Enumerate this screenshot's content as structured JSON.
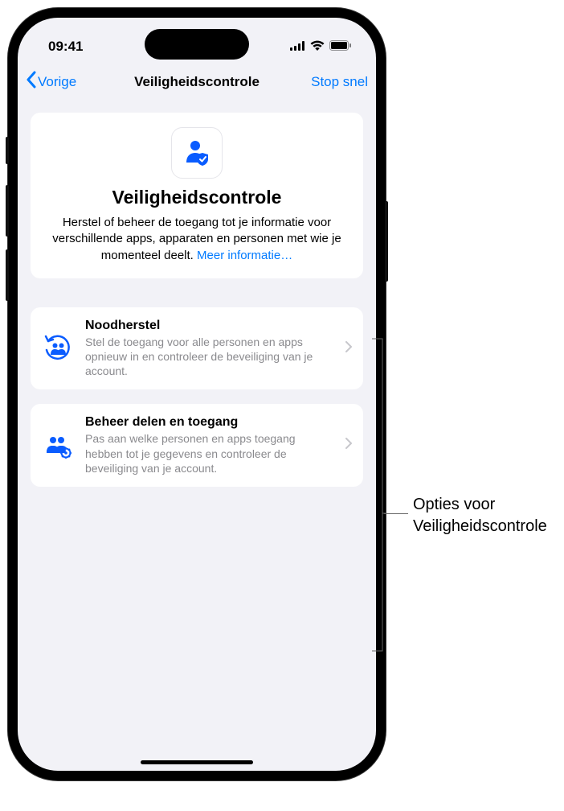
{
  "status": {
    "time": "09:41"
  },
  "nav": {
    "back_label": "Vorige",
    "title": "Veiligheidscontrole",
    "action_label": "Stop snel"
  },
  "header_card": {
    "title": "Veiligheidscontrole",
    "description": "Herstel of beheer de toegang tot je informatie voor verschillende apps, apparaten en personen met wie je momenteel deelt. ",
    "link": "Meer informatie…"
  },
  "options": [
    {
      "title": "Noodherstel",
      "description": "Stel de toegang voor alle personen en apps opnieuw in en controleer de beveiliging van je account."
    },
    {
      "title": "Beheer delen en toegang",
      "description": "Pas aan welke personen en apps toegang hebben tot je gegevens en controleer de beveiliging van je account."
    }
  ],
  "callout": {
    "text": "Opties voor Veiligheidscontrole"
  }
}
